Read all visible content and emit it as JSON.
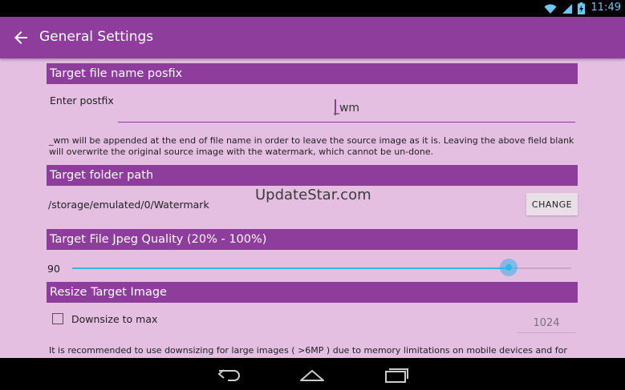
{
  "status_bar": {
    "time": "11:49",
    "battery_level": "100",
    "icons": [
      "wifi-icon",
      "signal-icon",
      "battery-charging-icon"
    ]
  },
  "app_bar": {
    "title": "General Settings",
    "back_icon": "arrow-left-icon"
  },
  "sections": {
    "posfix": {
      "header": "Target file name posfix",
      "label": "Enter postfix",
      "value": "_wm",
      "description": "_wm will be appended at the end of file name in order to leave the source image as it is. Leaving the above field blank will overwrite the original source image with the watermark, which cannot be un-done."
    },
    "folder": {
      "header": "Target folder path",
      "path": "/storage/emulated/0/Watermark",
      "change_label": "CHANGE"
    },
    "quality": {
      "header": "Target File Jpeg Quality (20% - 100%)",
      "value_text": "90",
      "value": 90,
      "min": 20,
      "max": 100
    },
    "resize": {
      "header": "Resize Target Image",
      "checkbox_label": "Downsize to max",
      "checked": false,
      "max_placeholder": "1024",
      "description": "It is recommended to use downsizing for large images ( >6MP ) due to memory limitations on mobile devices and for reducing"
    }
  },
  "overlay": {
    "watermark": "UpdateStar.com"
  },
  "colors": {
    "accent": "#8e3d9c",
    "background": "#e4bfe2",
    "slider": "#33b5e5"
  },
  "nav_bar": {
    "buttons": [
      "back-icon",
      "home-icon",
      "recents-icon"
    ]
  }
}
